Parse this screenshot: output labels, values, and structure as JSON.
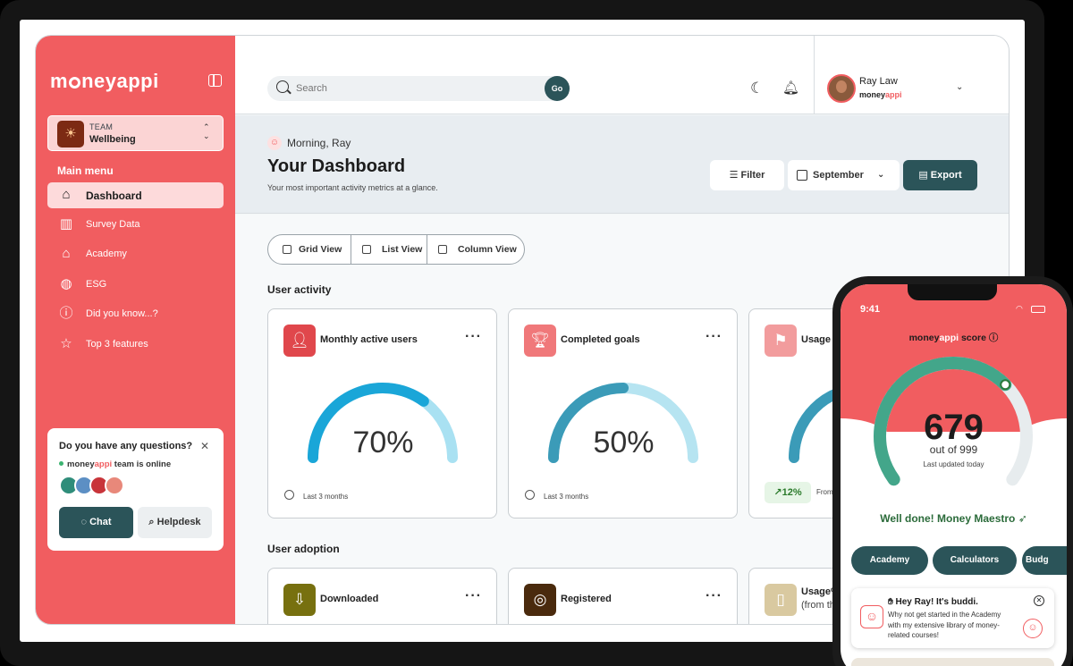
{
  "brand": {
    "logo_text_a": "m",
    "logo_text_b": "ney",
    "logo_text_c": "appi",
    "logo_full": "moneyappi",
    "name_a": "money",
    "name_b": "appi"
  },
  "team": {
    "label": "TEAM",
    "name": "Wellbeing"
  },
  "sidebar": {
    "main_menu_label": "Main menu",
    "items": [
      {
        "label": "Dashboard",
        "icon": "home-icon"
      },
      {
        "label": "Survey Data",
        "icon": "bar-chart-icon"
      },
      {
        "label": "Academy",
        "icon": "graduation-cap-icon"
      },
      {
        "label": "ESG",
        "icon": "globe-icon"
      },
      {
        "label": "Did you know...?",
        "icon": "question-icon"
      },
      {
        "label": "Top 3 features",
        "icon": "star-icon"
      }
    ]
  },
  "help": {
    "question": "Do you have any questions?",
    "online_suffix": " team is online",
    "chat_label": "Chat",
    "helpdesk_label": "Helpdesk"
  },
  "header": {
    "search_placeholder": "Search",
    "go_label": "Go",
    "user_name": "Ray Law"
  },
  "page": {
    "greeting": "Morning, Ray",
    "title": "Your Dashboard",
    "subtitle": "Your most important activity metrics at a glance.",
    "filter_label": "Filter",
    "month_label": "September",
    "export_label": "Export"
  },
  "views": [
    {
      "label": "Grid View"
    },
    {
      "label": "List View"
    },
    {
      "label": "Column View"
    }
  ],
  "sections": {
    "activity": "User activity",
    "adoption": "User adoption"
  },
  "activity_cards": [
    {
      "title": "Monthly active users",
      "percent": 70,
      "percent_label": "70%",
      "period": "Last 3 months",
      "icon_color": "#e0474c"
    },
    {
      "title": "Completed goals",
      "percent": 50,
      "percent_label": "50%",
      "period": "Last 3 months",
      "icon_color": "#f0787a"
    },
    {
      "title": "Usage s",
      "percent": 50,
      "change": "12%",
      "from": "From",
      "icon_color": "#f29c9d"
    }
  ],
  "adoption_cards": [
    {
      "title": "Downloaded",
      "icon_color": "#77700f"
    },
    {
      "title": "Registered",
      "icon_color": "#4a2a0d"
    },
    {
      "title": "Usage%",
      "subtitle": "(from th",
      "icon_color": "#d9c9a0"
    }
  ],
  "phone": {
    "time": "9:41",
    "score_title_a": "money",
    "score_title_b": "appi",
    "score_title_c": " score",
    "score": 679,
    "score_label": "679",
    "score_max": 999,
    "out_of": "out of 999",
    "updated": "Last updated today",
    "message": "Well done! Money Maestro",
    "buttons": [
      {
        "label": "Academy"
      },
      {
        "label": "Calculators"
      },
      {
        "label": "Budg"
      }
    ],
    "buddi_title": "Hey Ray! It's buddi.",
    "buddi_body": "Why not get started in the Academy with my extensive library of money-related courses!"
  },
  "colors": {
    "primary": "#f15d60",
    "teal": "#2b5459",
    "gauge_blue": "#1aa6d8",
    "gauge_light": "#a9e1f2"
  }
}
